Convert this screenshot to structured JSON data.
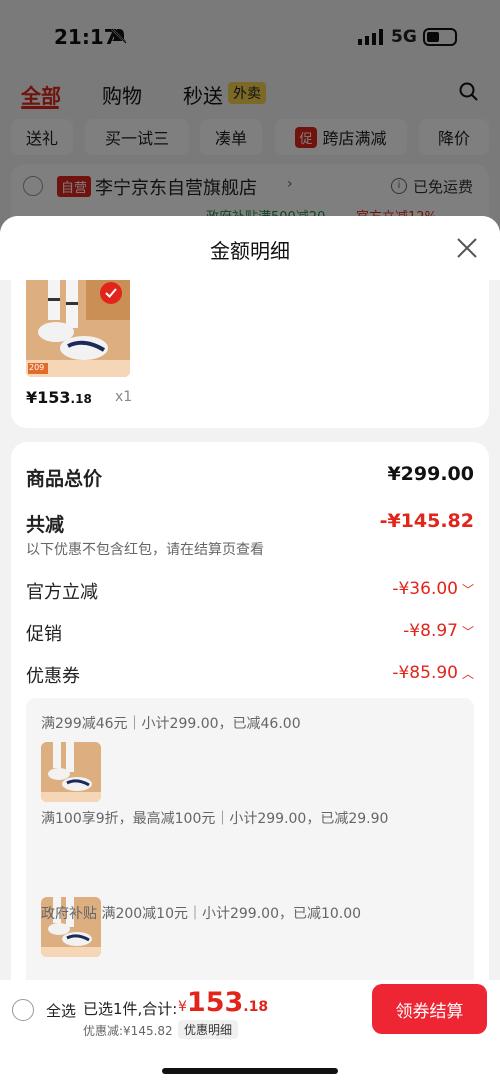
{
  "status": {
    "time": "21:17",
    "network": "5G"
  },
  "tabs": [
    {
      "label": "全部"
    },
    {
      "label": "购物"
    },
    {
      "label": "秒送"
    }
  ],
  "tab_badge": "外卖",
  "filters": [
    "送礼",
    "买一试三",
    "凑单",
    "跨店满减",
    "降价"
  ],
  "filter_tag": "促",
  "store": {
    "badge": "自营",
    "name": "李宁京东自营旗舰店",
    "shipping": "已免运费",
    "promo": "政府补贴满500减20",
    "promo2": "官方立减12%"
  },
  "sheet": {
    "title": "金额明细",
    "product": {
      "price_main": "¥153",
      "price_decimal": ".18",
      "qty": "x1",
      "thumb_tag": "209"
    },
    "rows": {
      "total_label": "商品总价",
      "total_value": "¥299.00",
      "reduce_label": "共减",
      "reduce_value": "-¥145.82",
      "reduce_note": "以下优惠不包含红包，请在结算页查看",
      "official_label": "官方立减",
      "official_value": "-¥36.00",
      "promo_label": "促销",
      "promo_value": "-¥8.97",
      "coupon_label": "优惠券",
      "coupon_value": "-¥85.90"
    },
    "coupons": [
      {
        "text": "满299减46元｜小计299.00，已减46.00"
      },
      {
        "text": "满100享9折，最高减100元｜小计299.00，已减29.90"
      },
      {
        "text": "政府补贴 满200减10元｜小计299.00，已减10.00"
      }
    ]
  },
  "bottom": {
    "select_all": "全选",
    "selected": "已选1件,合计:",
    "price_symbol": "¥",
    "price_main": "153",
    "price_decimal": ".18",
    "discount": "优惠减:¥145.82",
    "detail_btn": "优惠明细",
    "checkout": "领券结算"
  },
  "colors": {
    "accent": "#e1251b",
    "checkout": "#ee2532"
  }
}
